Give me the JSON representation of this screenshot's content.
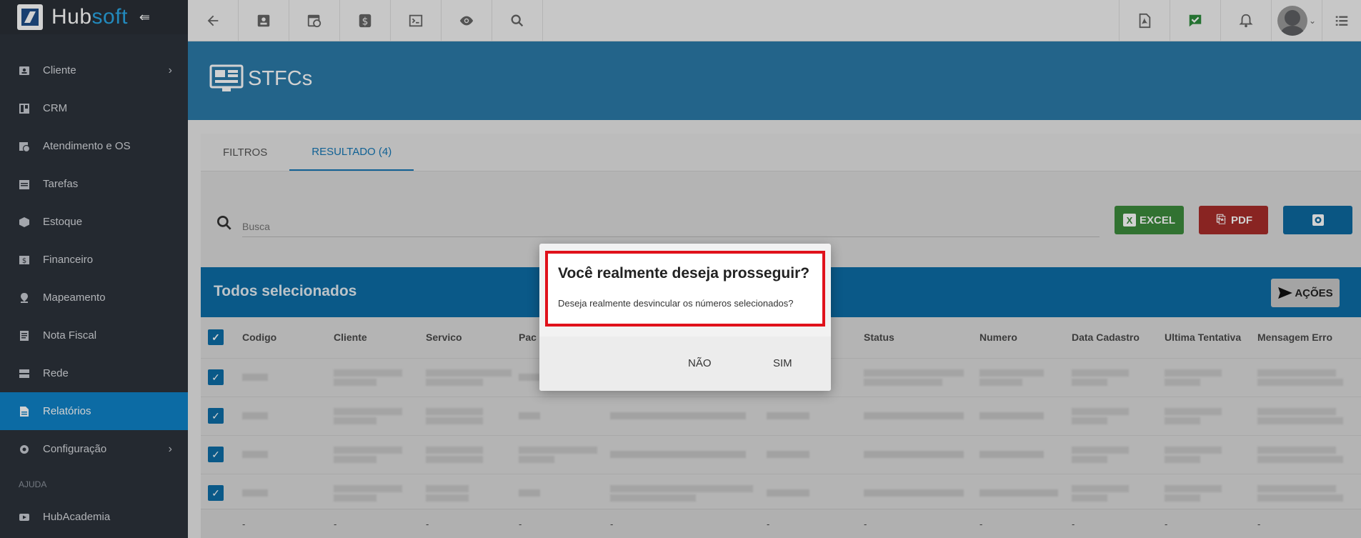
{
  "brand": {
    "name_part1": "Hub",
    "name_part2": "soft"
  },
  "sidebar": {
    "items": [
      {
        "label": "Cliente",
        "icon": "contact-card-icon",
        "has_chevron": true
      },
      {
        "label": "CRM",
        "icon": "board-icon"
      },
      {
        "label": "Atendimento e OS",
        "icon": "calendar-clock-icon"
      },
      {
        "label": "Tarefas",
        "icon": "calendar-tasks-icon"
      },
      {
        "label": "Estoque",
        "icon": "box-icon"
      },
      {
        "label": "Financeiro",
        "icon": "money-icon"
      },
      {
        "label": "Mapeamento",
        "icon": "map-pin-icon"
      },
      {
        "label": "Nota Fiscal",
        "icon": "document-icon"
      },
      {
        "label": "Rede",
        "icon": "server-icon"
      },
      {
        "label": "Relatórios",
        "icon": "report-icon",
        "active": true
      },
      {
        "label": "Configuração",
        "icon": "gear-icon",
        "has_chevron": true
      }
    ],
    "section_label": "AJUDA",
    "help_items": [
      {
        "label": "HubAcademia",
        "icon": "video-icon"
      }
    ]
  },
  "page": {
    "title": "STFCs"
  },
  "tabs": [
    {
      "label": "FILTROS"
    },
    {
      "label": "RESULTADO (4)",
      "active": true
    }
  ],
  "search": {
    "placeholder": "Busca"
  },
  "buttons": {
    "excel": "EXCEL",
    "pdf": "PDF"
  },
  "selection": {
    "label": "Todos selecionados",
    "actions": "AÇÕES"
  },
  "table": {
    "headers": [
      "Codigo",
      "Cliente",
      "Servico",
      "Pac",
      "",
      "",
      "Status",
      "Numero",
      "Data Cadastro",
      "Ultima Tentativa",
      "Mensagem Erro"
    ],
    "row_count": 4,
    "footer": [
      "-",
      "-",
      "-",
      "-",
      "-",
      "-",
      "-",
      "-",
      "-",
      "-",
      "-"
    ]
  },
  "dialog": {
    "title": "Você realmente deseja prosseguir?",
    "message": "Deseja realmente desvincular os números selecionados?",
    "no_label": "NÃO",
    "yes_label": "SIM"
  },
  "colors": {
    "sidebar": "#2d333b",
    "active": "#0f83c8",
    "band": "#2b7ba9",
    "highlight": "#e0121b"
  }
}
